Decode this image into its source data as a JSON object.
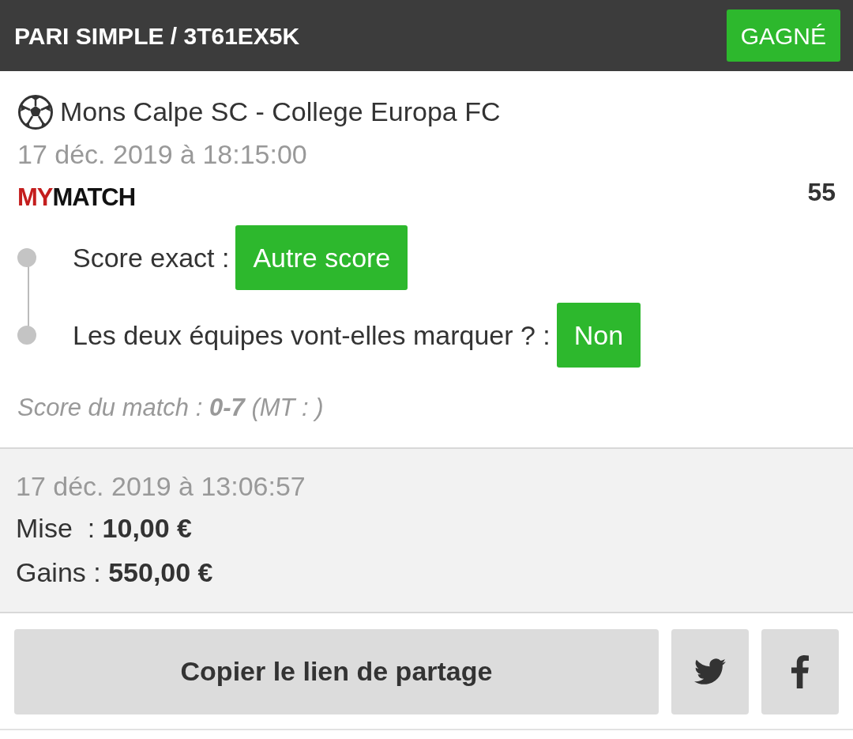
{
  "header": {
    "title": "PARI SIMPLE / 3T61EX5K",
    "status": {
      "label": "GAGNÉ",
      "kind": "won"
    }
  },
  "event": {
    "match": "Mons Calpe SC - College Europa FC",
    "date": "17 déc. 2019 à 18:15:00"
  },
  "bet_type": {
    "logo": {
      "accent": "MY",
      "rest": "MATCH"
    },
    "odds": "55"
  },
  "selections": [
    {
      "label": "Score exact :",
      "value": "Autre score",
      "kind": "won"
    },
    {
      "label": "Les deux équipes vont-elles marquer ? :",
      "value": "Non",
      "kind": "won"
    }
  ],
  "match_score": "Score du match : **0-7** (MT : )",
  "summary": {
    "placed": "17 déc. 2019 à 13:06:57",
    "stake": "Mise  : **10,00 €**",
    "winnings": "Gains : **550,00 €**"
  },
  "actions": {
    "copy_link": "Copier le lien de partage"
  }
}
